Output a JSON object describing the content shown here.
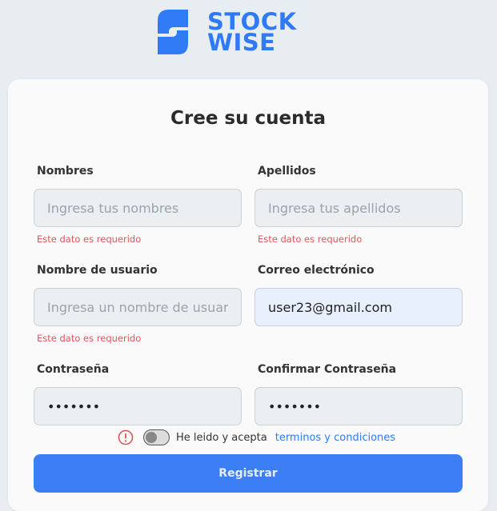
{
  "brand": {
    "line1": "STOCK",
    "line2": "WISE",
    "color": "#2f7bf5"
  },
  "form": {
    "title": "Cree su cuenta",
    "fields": {
      "nombres": {
        "label": "Nombres",
        "placeholder": "Ingresa tus nombres",
        "value": "",
        "error": "Este dato es requerido"
      },
      "apellidos": {
        "label": "Apellidos",
        "placeholder": "Ingresa tus apellidos",
        "value": "",
        "error": "Este dato es requerido"
      },
      "usuario": {
        "label": "Nombre de usuario",
        "placeholder": "Ingresa un nombre de usuario",
        "value": "",
        "error": "Este dato es requerido"
      },
      "correo": {
        "label": "Correo electrónico",
        "placeholder": "",
        "value": "user23@gmail.com"
      },
      "password": {
        "label": "Contraseña",
        "value": "1234567"
      },
      "confirm": {
        "label": "Confirmar Contraseña",
        "value": "1234567"
      }
    },
    "terms": {
      "prefix": "He leido y acepta",
      "link": "terminos y condiciones",
      "accepted": false
    },
    "submit_label": "Registrar",
    "error_color": "#e0575b",
    "accent": "#3b7ef6"
  }
}
